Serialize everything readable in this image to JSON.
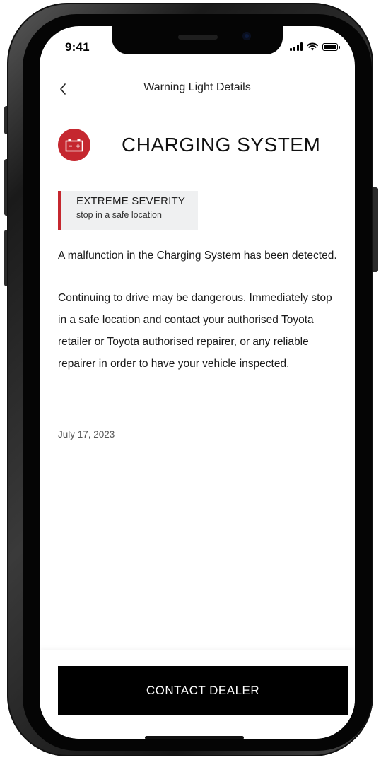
{
  "status_bar": {
    "time": "9:41",
    "icons": [
      "signal-icon",
      "wifi-icon",
      "battery-icon"
    ]
  },
  "header": {
    "back_icon": "chevron-left-icon",
    "title": "Warning Light Details"
  },
  "warning": {
    "icon": "battery-warning-icon",
    "icon_color": "#c5272f",
    "title": "CHARGING SYSTEM",
    "severity_level": "EXTREME SEVERITY",
    "severity_action": "stop in a safe location",
    "severity_color": "#c5272f",
    "description": "A malfunction in the Charging System has been detected.",
    "instructions": "Continuing to drive may be dangerous. Immediately stop in a safe location and contact your authorised Toyota retailer or Toyota authorised repairer, or any reliable repairer in order to have your vehicle inspected.",
    "date": "July 17, 2023"
  },
  "actions": {
    "contact_dealer_label": "CONTACT DEALER"
  }
}
